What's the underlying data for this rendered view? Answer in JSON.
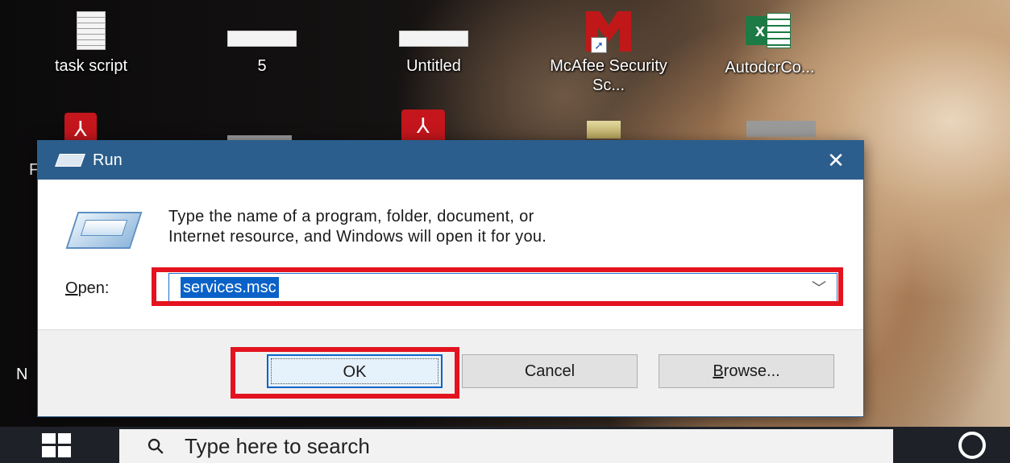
{
  "desktop": {
    "icons": [
      {
        "label": "task script",
        "icon": "text-document-icon"
      },
      {
        "label": "5",
        "icon": "image-thumbnail-icon"
      },
      {
        "label": "Untitled",
        "icon": "image-thumbnail-icon"
      },
      {
        "label": "McAfee Security Sc...",
        "icon": "mcafee-shortcut-icon"
      },
      {
        "label": "AutodcrCo...",
        "icon": "excel-file-icon"
      }
    ],
    "partial_labels": [
      "F",
      "N"
    ]
  },
  "run_dialog": {
    "title": "Run",
    "close_glyph": "✕",
    "description_line1": "Type the name of a program, folder, document, or",
    "description_line2": "Internet resource, and Windows will open it for you.",
    "open_label_mnemonic": "O",
    "open_label_rest": "pen:",
    "open_value": "services.msc",
    "dropdown_glyph": "﹀",
    "buttons": {
      "ok": "OK",
      "cancel": "Cancel",
      "browse_mnemonic": "B",
      "browse_rest": "rowse..."
    }
  },
  "taskbar": {
    "search_placeholder": "Type here to search",
    "search_glyph": "⚲"
  },
  "colors": {
    "titlebar": "#2b5e8c",
    "highlight": "#e3131f",
    "selection": "#0a62c8"
  }
}
